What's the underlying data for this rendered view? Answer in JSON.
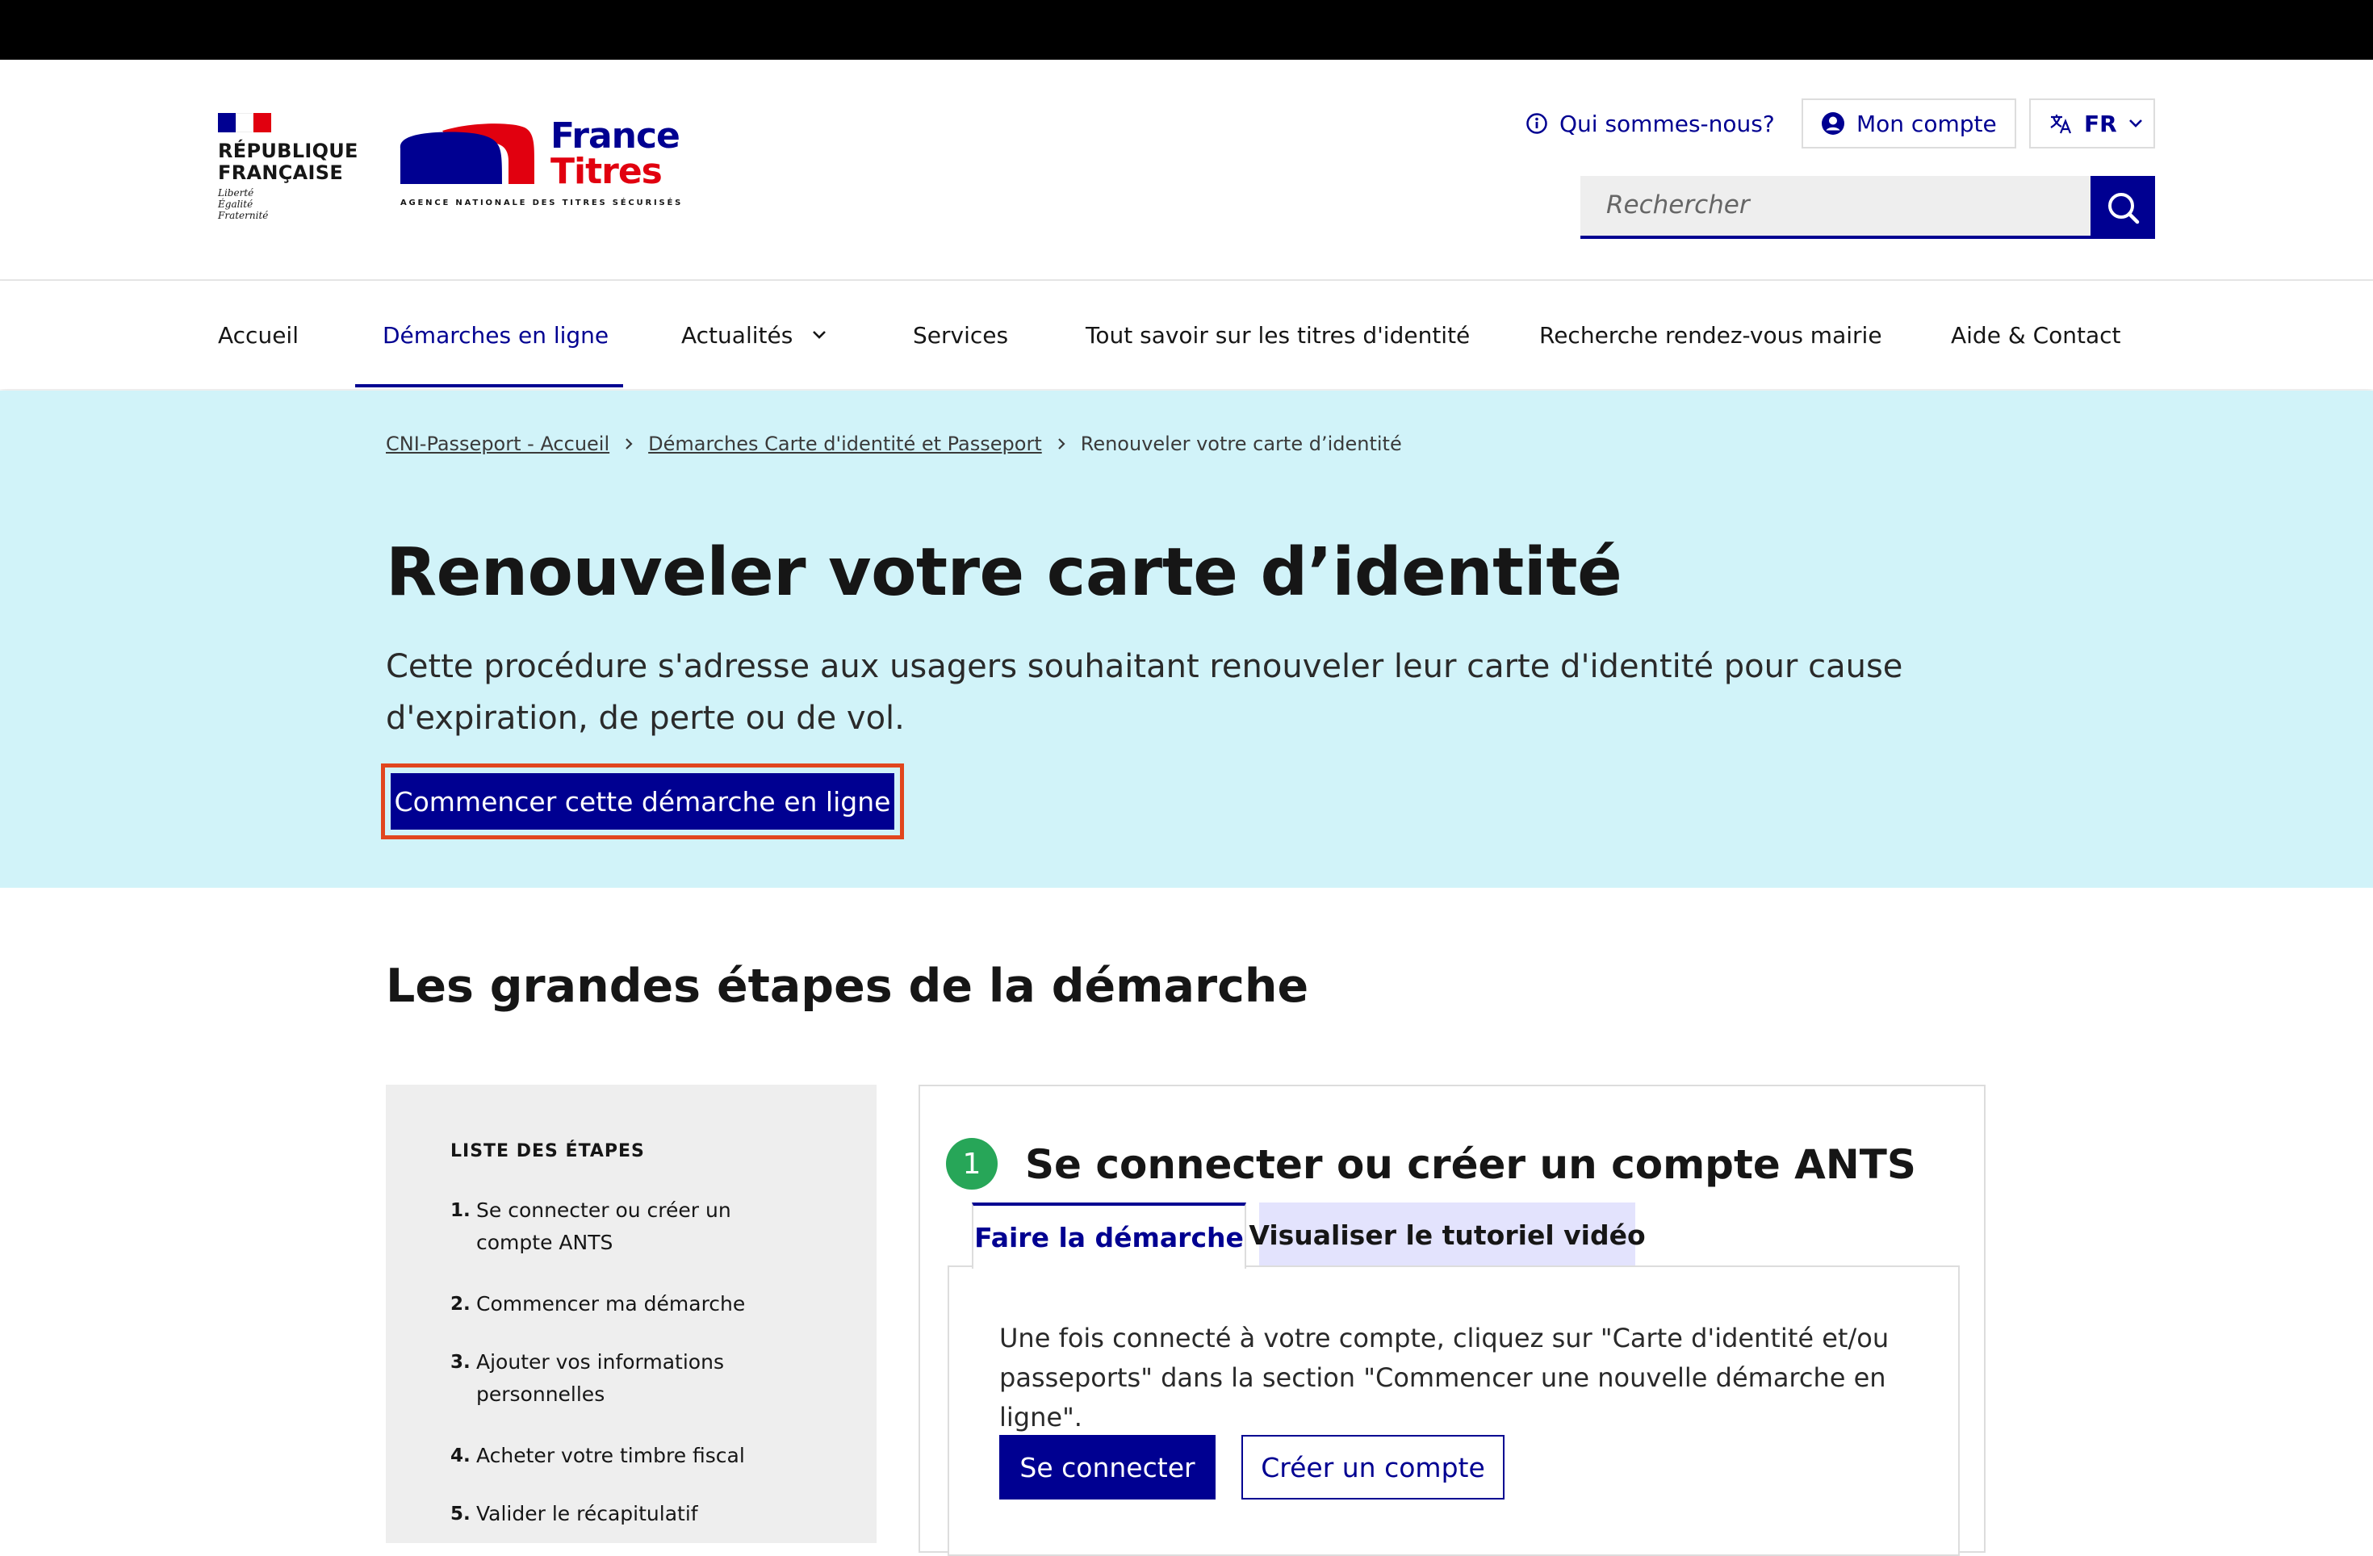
{
  "header": {
    "republique": "RÉPUBLIQUE FRANÇAISE",
    "motto": [
      "Liberté",
      "Égalité",
      "Fraternité"
    ],
    "brand_line1": "France",
    "brand_line2": "Titres",
    "brand_tagline": "AGENCE NATIONALE DES TITRES SÉCURISÉS",
    "who_link": "Qui sommes-nous?",
    "account_button": "Mon compte",
    "language": "FR",
    "search_placeholder": "Rechercher",
    "icons": {
      "who": "info-icon",
      "account": "user-circle-icon",
      "language": "translate-icon",
      "search": "search-icon"
    }
  },
  "nav": {
    "items": [
      {
        "label": "Accueil"
      },
      {
        "label": "Démarches en ligne",
        "active": true
      },
      {
        "label": "Actualités",
        "dropdown": true
      },
      {
        "label": "Services"
      },
      {
        "label": "Tout savoir sur les titres d'identité"
      },
      {
        "label": "Recherche rendez-vous mairie"
      },
      {
        "label": "Aide & Contact"
      }
    ]
  },
  "breadcrumb": {
    "items": [
      "CNI-Passeport - Accueil",
      "Démarches Carte d'identité et Passeport",
      "Renouveler votre carte d’identité"
    ]
  },
  "hero": {
    "title": "Renouveler votre carte d’identité",
    "lead": "Cette procédure s'adresse aux usagers souhaitant renouveler leur carte d'identité pour cause d'expiration, de perte ou de vol.",
    "cta": "Commencer cette démarche en ligne"
  },
  "section": {
    "title": "Les grandes étapes de la démarche",
    "steps_title": "LISTE DES ÉTAPES",
    "steps": [
      {
        "num": "1.",
        "label": "Se connecter ou créer un compte ANTS"
      },
      {
        "num": "2.",
        "label": "Commencer ma démarche"
      },
      {
        "num": "3.",
        "label": "Ajouter vos informations personnelles"
      },
      {
        "num": "4.",
        "label": "Acheter votre timbre fiscal"
      },
      {
        "num": "5.",
        "label": "Valider le récapitulatif"
      }
    ]
  },
  "step_card": {
    "number": "1",
    "title": "Se connecter ou créer un compte ANTS",
    "tabs": [
      "Faire la démarche",
      "Visualiser le tutoriel vidéo"
    ],
    "text": "Une fois connecté à votre compte, cliquez sur \"Carte d'identité et/ou passeports\" dans la section \"Commencer une nouvelle démarche en ligne\".",
    "primary_button": "Se connecter",
    "secondary_button": "Créer un compte"
  },
  "colors": {
    "primary_blue": "#000091",
    "marianne_red": "#e1000f",
    "hero_background": "#d1f3f9",
    "step_green": "#27a658",
    "cta_highlight": "#e1461e"
  }
}
